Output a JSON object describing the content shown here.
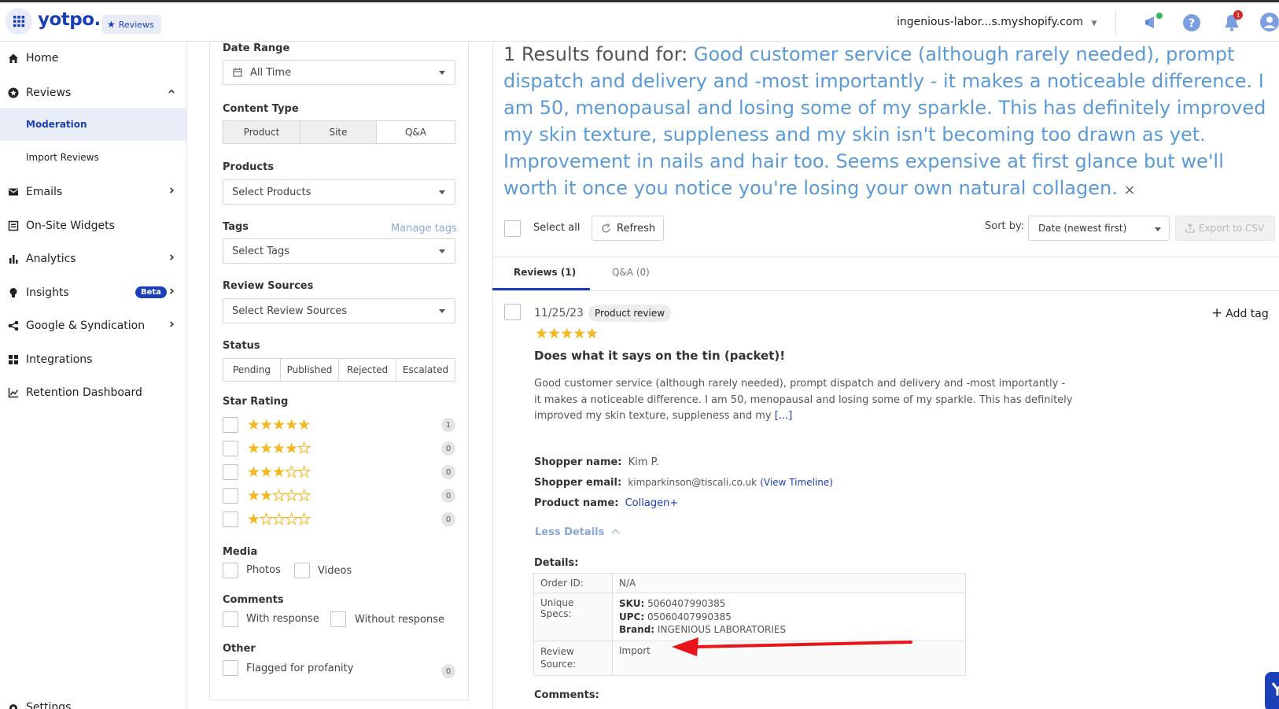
{
  "topbar": {
    "logo": "yotpo.",
    "product_badge": "Reviews",
    "store": "ingenious-labor...s.myshopify.com",
    "notification_count": "1",
    "colors": {
      "brand": "#1b3fb8",
      "accent_link": "#5b9ad6",
      "star": "#f3b81f"
    }
  },
  "sidebar": {
    "items": [
      {
        "label": "Home",
        "icon": "home-icon"
      },
      {
        "label": "Reviews",
        "icon": "star-circle-icon"
      },
      {
        "label": "Moderation"
      },
      {
        "label": "Import Reviews"
      },
      {
        "label": "Emails",
        "icon": "mail-icon"
      },
      {
        "label": "On-Site Widgets",
        "icon": "widget-icon"
      },
      {
        "label": "Analytics",
        "icon": "bar-chart-icon"
      },
      {
        "label": "Insights",
        "icon": "bulb-icon",
        "badge": "Beta"
      },
      {
        "label": "Google & Syndication",
        "icon": "share-icon"
      },
      {
        "label": "Integrations",
        "icon": "grid-icon"
      },
      {
        "label": "Retention Dashboard",
        "icon": "line-chart-icon"
      },
      {
        "label": "Settings",
        "icon": "gear-icon"
      }
    ]
  },
  "filters": {
    "date_range": {
      "label": "Date Range",
      "value": "All Time"
    },
    "content_type": {
      "label": "Content Type",
      "options": [
        "Product",
        "Site",
        "Q&A"
      ]
    },
    "products": {
      "label": "Products",
      "placeholder": "Select Products"
    },
    "tags": {
      "label": "Tags",
      "placeholder": "Select Tags",
      "manage": "Manage tags"
    },
    "review_sources": {
      "label": "Review Sources",
      "placeholder": "Select Review Sources"
    },
    "status": {
      "label": "Status",
      "options": [
        "Pending",
        "Published",
        "Rejected",
        "Escalated"
      ]
    },
    "star_rating": {
      "label": "Star Rating",
      "rows": [
        {
          "stars": 5,
          "count": "1"
        },
        {
          "stars": 4,
          "count": "0"
        },
        {
          "stars": 3,
          "count": "0"
        },
        {
          "stars": 2,
          "count": "0"
        },
        {
          "stars": 1,
          "count": "0"
        }
      ]
    },
    "media": {
      "label": "Media",
      "photos": "Photos",
      "videos": "Videos"
    },
    "comments": {
      "label": "Comments",
      "with": "With response",
      "without": "Without response"
    },
    "other": {
      "label": "Other",
      "flagged": "Flagged for profanity",
      "flagged_count": "0"
    }
  },
  "results": {
    "prefix": "1 Results found for: ",
    "query": "Good customer service (although rarely needed), prompt dispatch and delivery and -most importantly - it makes a noticeable difference. I am 50, menopausal and losing some of my sparkle. This has definitely improved my skin texture, suppleness and my skin isn't becoming too drawn as yet. Improvement in nails and hair too. Seems expensive at first glance but we'll worth it once you notice you're losing your own natural collagen.",
    "clear": "×"
  },
  "toolbar": {
    "select_all": "Select all",
    "refresh": "Refresh",
    "sort_label": "Sort by:",
    "sort_value": "Date (newest first)",
    "export": "Export to CSV"
  },
  "tabs": [
    {
      "label": "Reviews (1)"
    },
    {
      "label": "Q&A (0)"
    }
  ],
  "review": {
    "date": "11/25/23",
    "type": "Product review",
    "add_tag": "Add tag",
    "stars": 5,
    "title": "Does what it says on the tin (packet)!",
    "body_lines": [
      "Good customer service (although rarely needed), prompt dispatch and delivery and -most importantly -",
      "it makes a noticeable difference. I am 50, menopausal and losing some of my sparkle. This has definitely",
      "improved my skin texture, suppleness and my "
    ],
    "more": "[...]",
    "shopper_name_label": "Shopper name:",
    "shopper_name": "Kim P.",
    "shopper_email_label": "Shopper email:",
    "shopper_email": "kimparkinson@tiscali.co.uk",
    "timeline": "(View Timeline)",
    "product_name_label": "Product name:",
    "product_name": "Collagen+",
    "less_details": "Less Details",
    "details_label": "Details:",
    "details": {
      "order_id_label": "Order ID:",
      "order_id": "N/A",
      "specs_label": "Unique Specs:",
      "sku_label": "SKU:",
      "sku": "5060407990385",
      "upc_label": "UPC:",
      "upc": "05060407990385",
      "brand_label": "Brand:",
      "brand": "INGENIOUS LABORATORIES",
      "source_label_1": "Review",
      "source_label_2": "Source:",
      "source": "Import"
    },
    "comments_label": "Comments:"
  }
}
